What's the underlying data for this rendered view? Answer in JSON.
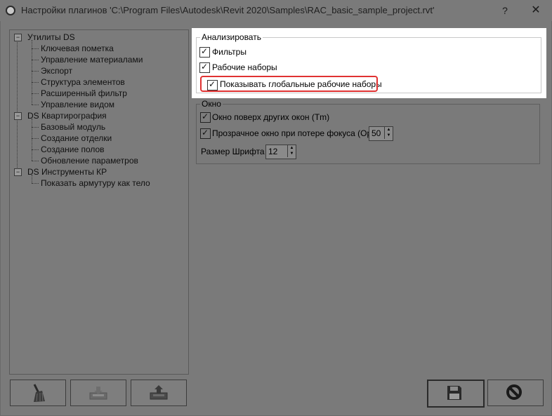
{
  "window": {
    "title": "Настройки плагинов 'C:\\Program Files\\Autodesk\\Revit 2020\\Samples\\RAC_basic_sample_project.rvt'",
    "help": "?",
    "close": "✕"
  },
  "tree": {
    "groups": [
      {
        "label": "Утилиты DS",
        "items": [
          "Ключевая пометка",
          "Управление материалами",
          "Экспорт",
          "Структура элементов",
          "Расширенный фильтр",
          "Управление видом"
        ]
      },
      {
        "label": "DS Квартирография",
        "items": [
          "Базовый модуль",
          "Создание отделки",
          "Создание полов",
          "Обновление параметров"
        ]
      },
      {
        "label": "DS Инструменты КР",
        "items": [
          "Показать армутуру как тело"
        ]
      }
    ],
    "expanded_symbol": "−"
  },
  "analyze": {
    "title": "Анализировать",
    "filters": "Фильтры",
    "worksets": "Рабочие наборы",
    "global_worksets": "Показывать глобальные рабочие наборы"
  },
  "window_group": {
    "title": "Окно",
    "topmost": "Окно поверх других окон (Tm)",
    "transparent": "Прозрачное окно при потере фокуса (Op)",
    "opacity_value": "50",
    "font_size_label": "Размер Шрифта",
    "font_size_value": "12"
  },
  "check_glyph": "✓",
  "spin_glyphs": {
    "up": "▲",
    "down": "▼"
  }
}
